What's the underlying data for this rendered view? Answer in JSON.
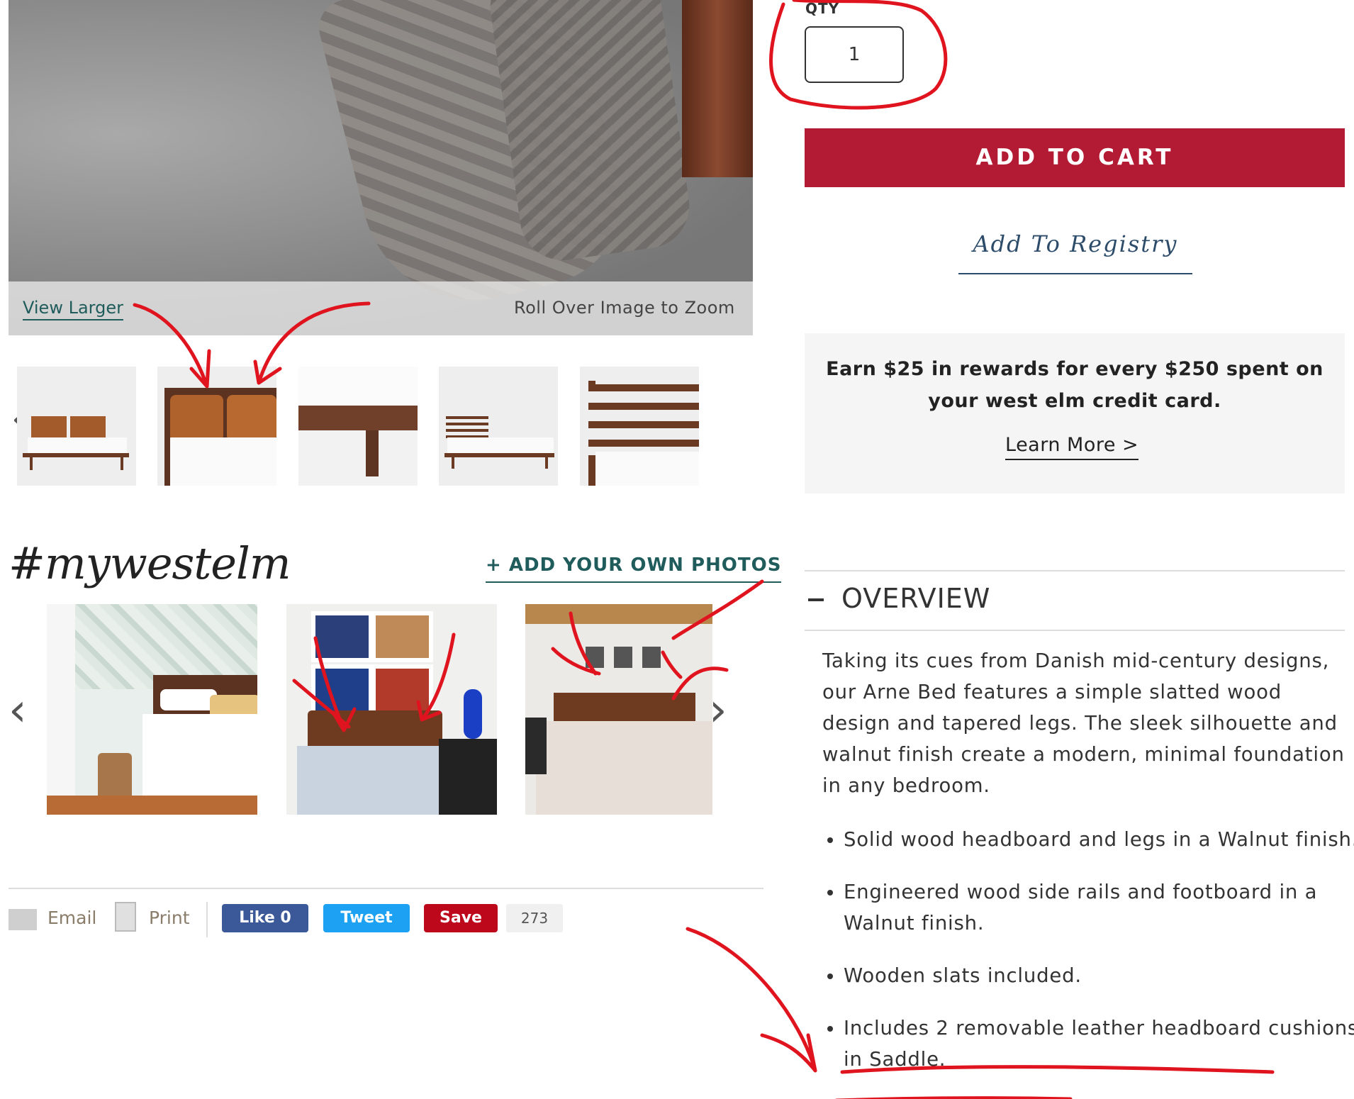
{
  "main_image": {
    "view_larger": "View Larger",
    "roll_over": "Roll Over Image to Zoom"
  },
  "purchase": {
    "qty_label": "QTY",
    "qty_value": "1",
    "add_to_cart": "ADD TO CART",
    "add_to_registry": "Add To Registry"
  },
  "rewards": {
    "text": "Earn $25 in rewards for every $250 spent on your west elm credit card.",
    "learn_more": "Learn More >"
  },
  "mywestelm": {
    "logo": "#mywestelm",
    "add_photos": "+ ADD YOUR OWN PHOTOS"
  },
  "share": {
    "email": "Email",
    "print": "Print",
    "like": "Like 0",
    "tweet": "Tweet",
    "save": "Save",
    "count": "273"
  },
  "overview": {
    "title": "OVERVIEW",
    "description": "Taking its cues from Danish mid-century designs, our Arne Bed features a simple slatted wood design and tapered legs. The sleek silhouette and walnut finish create a modern, minimal foundation in any bedroom.",
    "bullets": [
      "Solid wood headboard and legs in a Walnut finish.",
      "Engineered wood side rails and footboard in a Walnut finish.",
      "Wooden slats included.",
      "Includes 2 removable leather headboard cushions in Saddle."
    ]
  },
  "colors": {
    "accent_red": "#b31b34",
    "teal_link": "#1f5c5b",
    "registry_blue": "#2d4c6a",
    "annotation_red": "#e0141e"
  }
}
